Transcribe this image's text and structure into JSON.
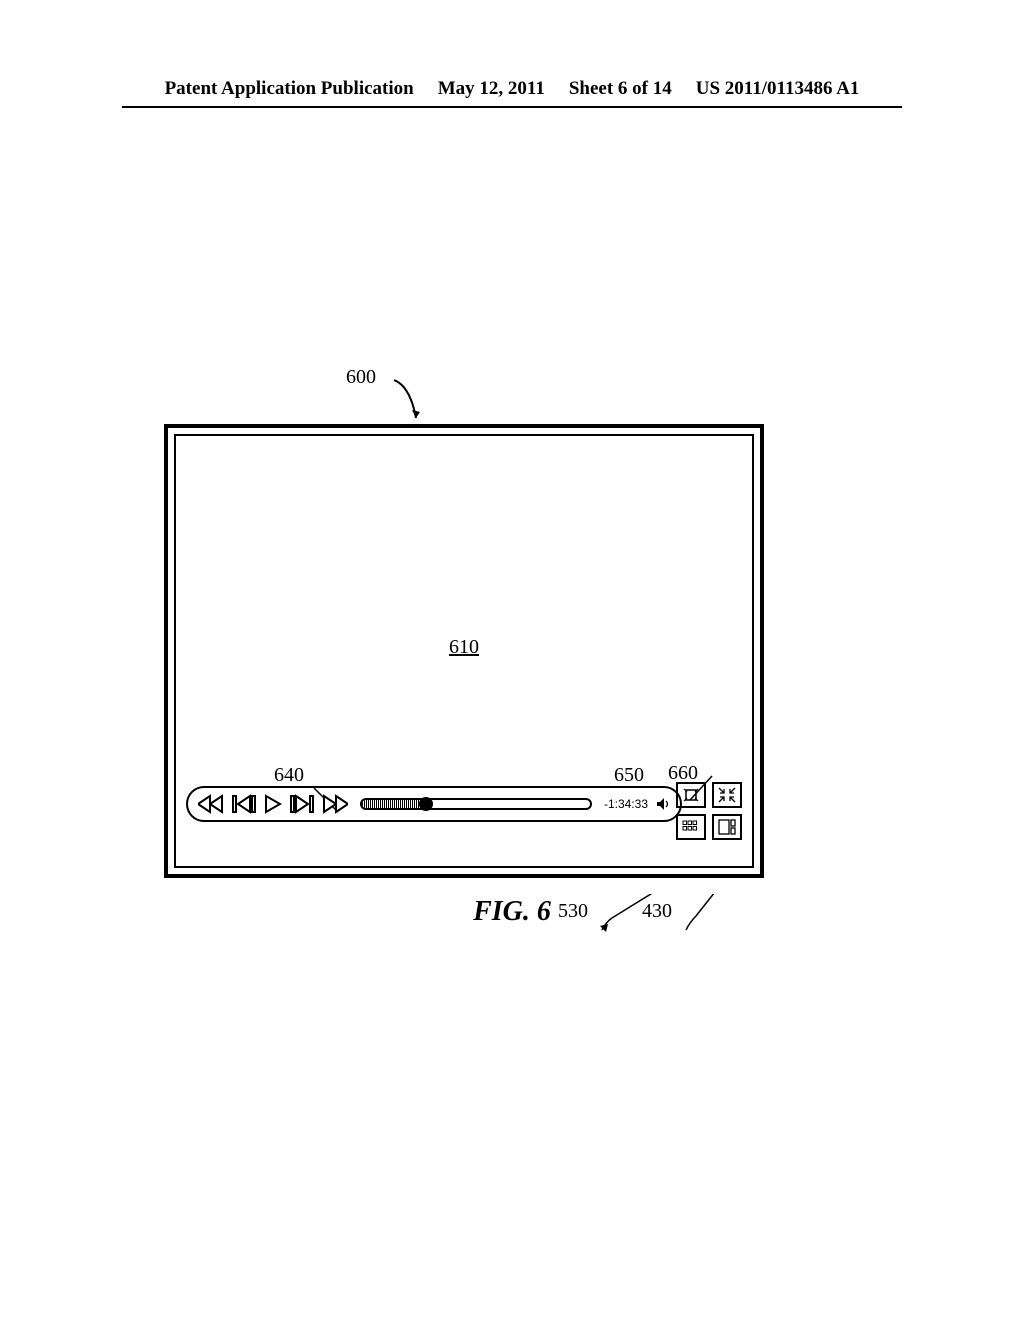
{
  "header": {
    "pub_type": "Patent Application Publication",
    "date": "May 12, 2011",
    "sheet": "Sheet 6 of 14",
    "pub_number": "US 2011/0113486 A1"
  },
  "refs": {
    "r600": "600",
    "r610": "610",
    "r640": "640",
    "r650": "650",
    "r660": "660",
    "r530": "530",
    "r430": "430"
  },
  "player": {
    "time_remaining": "-1:34:33"
  },
  "figure_label": "FIG. 6"
}
